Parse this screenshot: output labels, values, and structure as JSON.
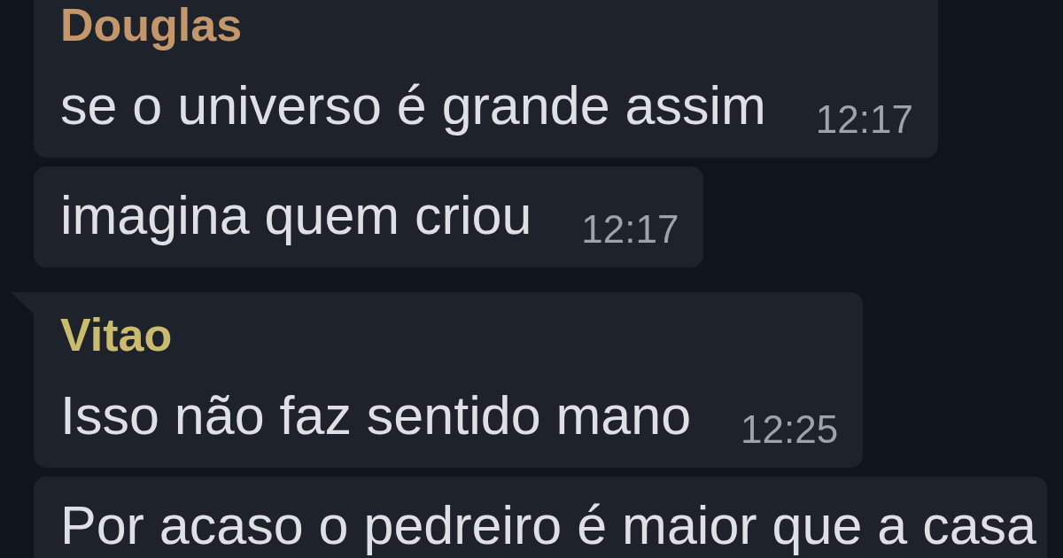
{
  "messages": [
    {
      "sender": "Douglas",
      "color": "#c4966c",
      "text": "se o universo é grande assim",
      "time": "12:17",
      "tail": false
    },
    {
      "text": "imagina quem criou",
      "time": "12:17",
      "tail": false
    },
    {
      "sender": "Vitao",
      "color": "#cbbb6e",
      "text": "Isso não faz sentido mano",
      "time": "12:25",
      "tail": true
    },
    {
      "text": "Por acaso o pedreiro é maior que a casa",
      "tail": false
    }
  ]
}
